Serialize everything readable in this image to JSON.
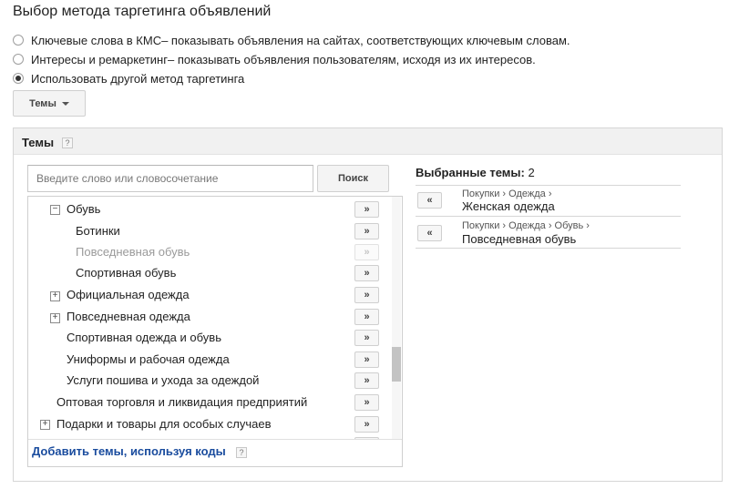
{
  "page": {
    "title": "Выбор метода таргетинга объявлений"
  },
  "targeting_options": [
    {
      "label": "Ключевые слова в КМС",
      "description": " – показывать объявления на сайтах, соответствующих ключевым словам.",
      "selected": false
    },
    {
      "label": "Интересы и ремаркетинг",
      "description": " – показывать объявления пользователям, исходя из их интересов.",
      "selected": false
    },
    {
      "label": "Использовать другой метод таргетинга",
      "description": "",
      "selected": true
    }
  ],
  "method_dropdown": {
    "selected": "Темы"
  },
  "topics_panel": {
    "title": "Темы",
    "help": "?",
    "search": {
      "placeholder": "Введите слово или словосочетание",
      "value": "",
      "button": "Поиск"
    },
    "tree": [
      {
        "label": "Обувь",
        "toggle": "−",
        "add": "»"
      },
      {
        "label": "Ботинки",
        "toggle": "",
        "add": "»"
      },
      {
        "label": "Повседневная обувь",
        "toggle": "",
        "add": "»"
      },
      {
        "label": "Спортивная обувь",
        "toggle": "",
        "add": "»"
      },
      {
        "label": "Официальная одежда",
        "toggle": "+",
        "add": "»"
      },
      {
        "label": "Повседневная одежда",
        "toggle": "+",
        "add": "»"
      },
      {
        "label": "Спортивная одежда и обувь",
        "toggle": "",
        "add": "»"
      },
      {
        "label": "Униформы и рабочая одежда",
        "toggle": "",
        "add": "»"
      },
      {
        "label": "Услуги пошива и ухода за одеждой",
        "toggle": "",
        "add": "»"
      },
      {
        "label": "Оптовая торговля и ликвидация предприятий",
        "toggle": "",
        "add": "»"
      },
      {
        "label": "Подарки и товары для особых случаев",
        "toggle": "+",
        "add": "»"
      }
    ],
    "add_by_codes": {
      "label": "Добавить темы, используя коды",
      "help": "?"
    }
  },
  "selected_topics": {
    "heading": "Выбранные темы:",
    "count": "2",
    "items": [
      {
        "path": "Покупки › Одежда ›",
        "name": "Женская одежда",
        "remove": "«"
      },
      {
        "path": "Покупки › Одежда › Обувь ›",
        "name": "Повседневная обувь",
        "remove": "«"
      }
    ]
  },
  "colors": {
    "link": "#1a4c9e",
    "disabled_text": "#9a9a9a",
    "panel_header": "#f1f1f1"
  }
}
